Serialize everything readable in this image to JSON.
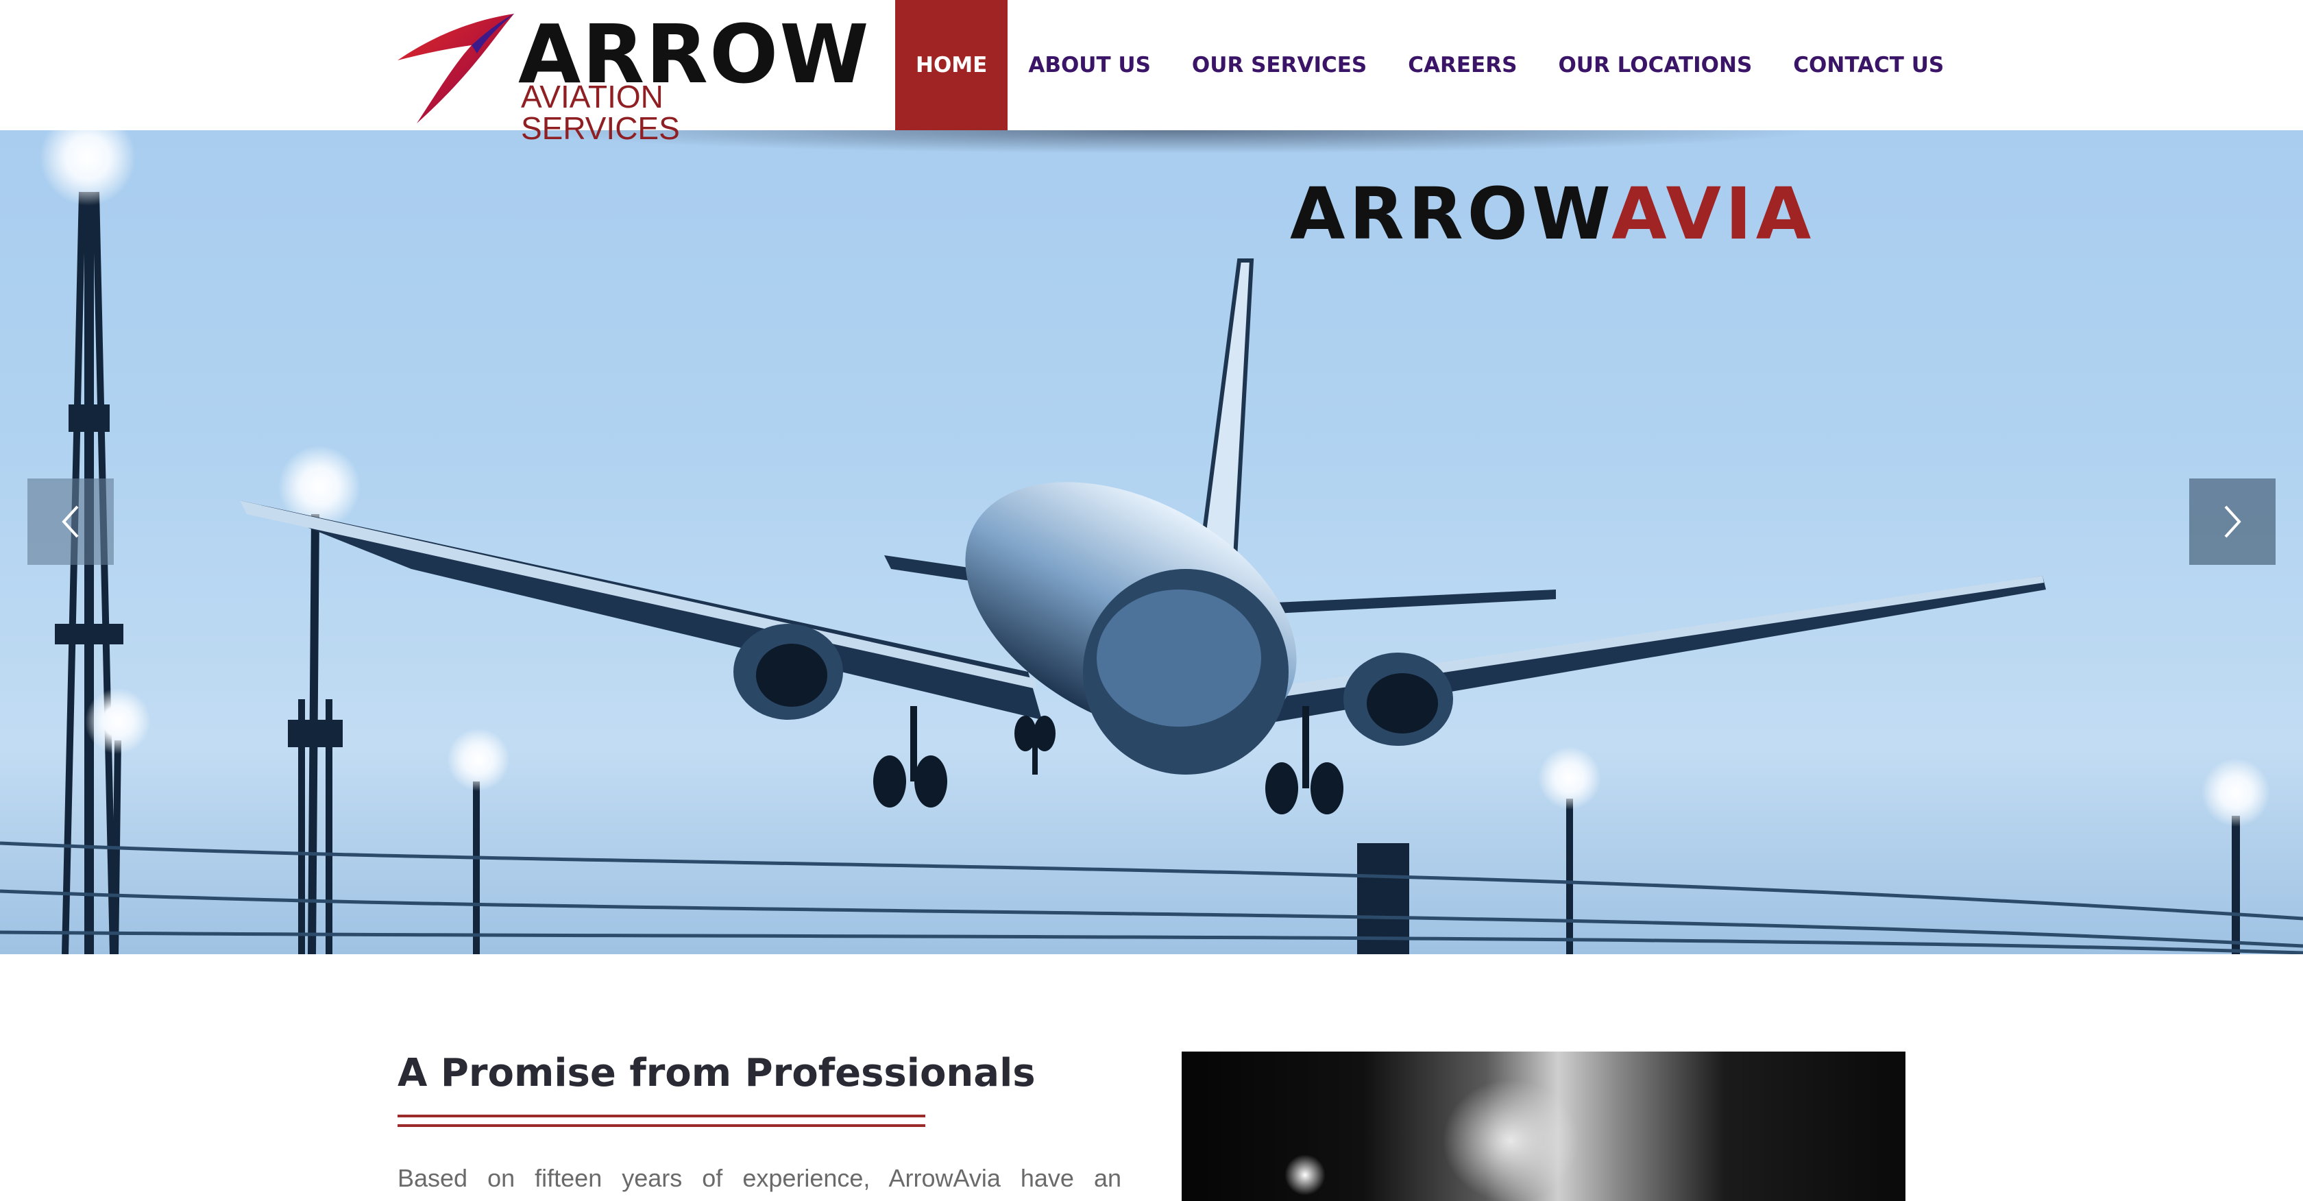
{
  "brand": {
    "word": "ARROW",
    "subtitle": "AVIATION SERVICES",
    "colors": {
      "primary": "#111111",
      "accent": "#a02424",
      "nav_text": "#3a1466"
    }
  },
  "nav": {
    "items": [
      {
        "label": "HOME",
        "active": true
      },
      {
        "label": "ABOUT US",
        "active": false
      },
      {
        "label": "OUR SERVICES",
        "active": false
      },
      {
        "label": "CAREERS",
        "active": false
      },
      {
        "label": "OUR LOCATIONS",
        "active": false
      },
      {
        "label": "CONTACT US",
        "active": false
      }
    ]
  },
  "hero": {
    "title_part1": "ARROW",
    "title_part2": "AVIA",
    "prev_icon": "chevron-left-icon",
    "next_icon": "chevron-right-icon"
  },
  "content": {
    "title": "A Promise from Professionals",
    "paragraph": "Based on fifteen years of experience, ArrowAvia have an"
  }
}
